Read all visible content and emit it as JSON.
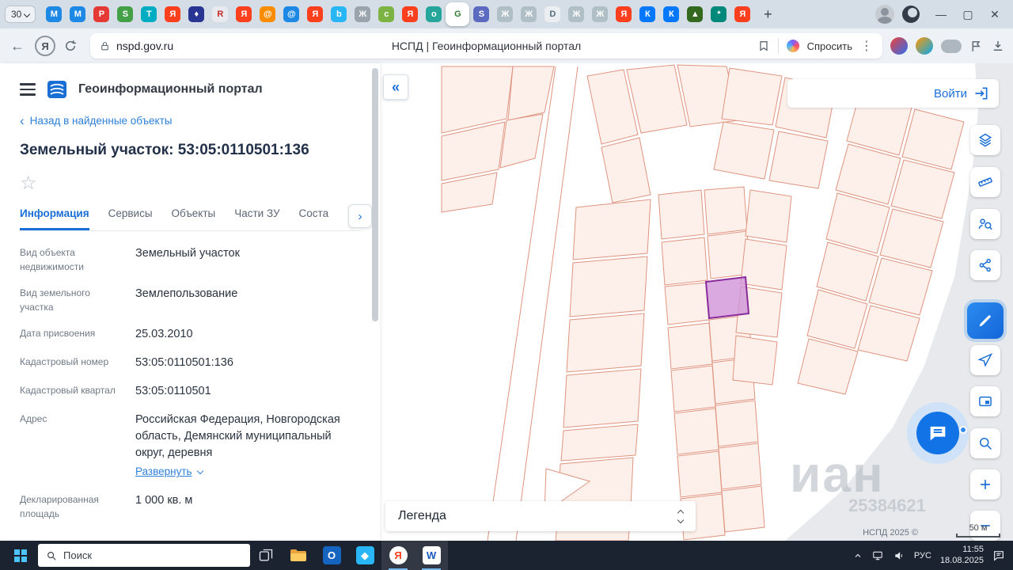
{
  "browser": {
    "tab_counter": "30",
    "new_tab": "+",
    "window_controls": {
      "minimize": "—",
      "maximize": "▢",
      "close": "✕"
    },
    "tabs": [
      {
        "bg": "#1e88e5",
        "glyph": "M"
      },
      {
        "bg": "#1e88e5",
        "glyph": "M"
      },
      {
        "bg": "#e53935",
        "glyph": "P"
      },
      {
        "bg": "#43a047",
        "glyph": "S"
      },
      {
        "bg": "#00acc1",
        "glyph": "T"
      },
      {
        "bg": "#fc3f1d",
        "glyph": "Я"
      },
      {
        "bg": "#283593",
        "glyph": "♦"
      },
      {
        "bg": "#e8eaf0",
        "glyph": "R",
        "fg": "#c62828"
      },
      {
        "bg": "#fc3f1d",
        "glyph": "Я"
      },
      {
        "bg": "#fb8c00",
        "glyph": "@"
      },
      {
        "bg": "#1e88e5",
        "glyph": "@"
      },
      {
        "bg": "#fc3f1d",
        "glyph": "Я"
      },
      {
        "bg": "#29b6f6",
        "glyph": "b"
      },
      {
        "bg": "#9aa4ad",
        "glyph": "Ж"
      },
      {
        "bg": "#7cb342",
        "glyph": "c"
      },
      {
        "bg": "#fc3f1d",
        "glyph": "Я"
      },
      {
        "bg": "#26a69a",
        "glyph": "o"
      },
      {
        "bg": "#ffffff",
        "glyph": "G",
        "fg": "#2e7d32",
        "active": true
      },
      {
        "bg": "#5c6bc0",
        "glyph": "S"
      },
      {
        "bg": "#b0bec5",
        "glyph": "Ж"
      },
      {
        "bg": "#b0bec5",
        "glyph": "Ж"
      },
      {
        "bg": "#eceff1",
        "glyph": "D",
        "fg": "#546e7a"
      },
      {
        "bg": "#b0bec5",
        "glyph": "Ж"
      },
      {
        "bg": "#b0bec5",
        "glyph": "Ж"
      },
      {
        "bg": "#fc3f1d",
        "glyph": "Я"
      },
      {
        "bg": "#0077ff",
        "glyph": "К"
      },
      {
        "bg": "#0077ff",
        "glyph": "К"
      },
      {
        "bg": "#33691e",
        "glyph": "▲"
      },
      {
        "bg": "#00897b",
        "glyph": "*"
      },
      {
        "bg": "#fc3f1d",
        "glyph": "Я"
      }
    ],
    "toolbar": {
      "url": "nspd.gov.ru",
      "page_title": "НСПД | Геоинформационный портал",
      "ask_label": "Спросить",
      "kebab": "⋮"
    }
  },
  "portal": {
    "title": "Геоинформационный портал",
    "back_link": "Назад в найденные объекты",
    "object_title": "Земельный участок: 53:05:0110501:136",
    "tabs": [
      {
        "label": "Информация",
        "active": true
      },
      {
        "label": "Сервисы"
      },
      {
        "label": "Объекты"
      },
      {
        "label": "Части ЗУ"
      },
      {
        "label": "Соста"
      }
    ],
    "fields": [
      {
        "label": "Вид объекта недвижимости",
        "value": "Земельный участок"
      },
      {
        "label": "Вид земельного участка",
        "value": "Землепользование"
      },
      {
        "label": "Дата присвоения",
        "value": "25.03.2010"
      },
      {
        "label": "Кадастровый номер",
        "value": "53:05:0110501:136"
      },
      {
        "label": "Кадастровый квартал",
        "value": "53:05:0110501"
      },
      {
        "label": "Адрес",
        "value": "Российская Федерация, Новгородская область, Демянский муниципальный округ, деревня",
        "expand_label": "Развернуть"
      },
      {
        "label": "Декларированная площадь",
        "value": "1 000 кв. м"
      }
    ]
  },
  "map": {
    "login_label": "Войти",
    "legend_label": "Легенда",
    "copyright": "НСПД 2025 ©",
    "scale_label": "50 м",
    "watermark_line1": "иан",
    "watermark_line2": "25384621",
    "parcel_fill": "#fdf0ea",
    "parcel_stroke": "#df9480",
    "selected_parcel_color": "#8a2b9b"
  },
  "taskbar": {
    "search_placeholder": "Поиск",
    "time": "11:55",
    "date": "18.08.2025",
    "lang": "РУС"
  }
}
